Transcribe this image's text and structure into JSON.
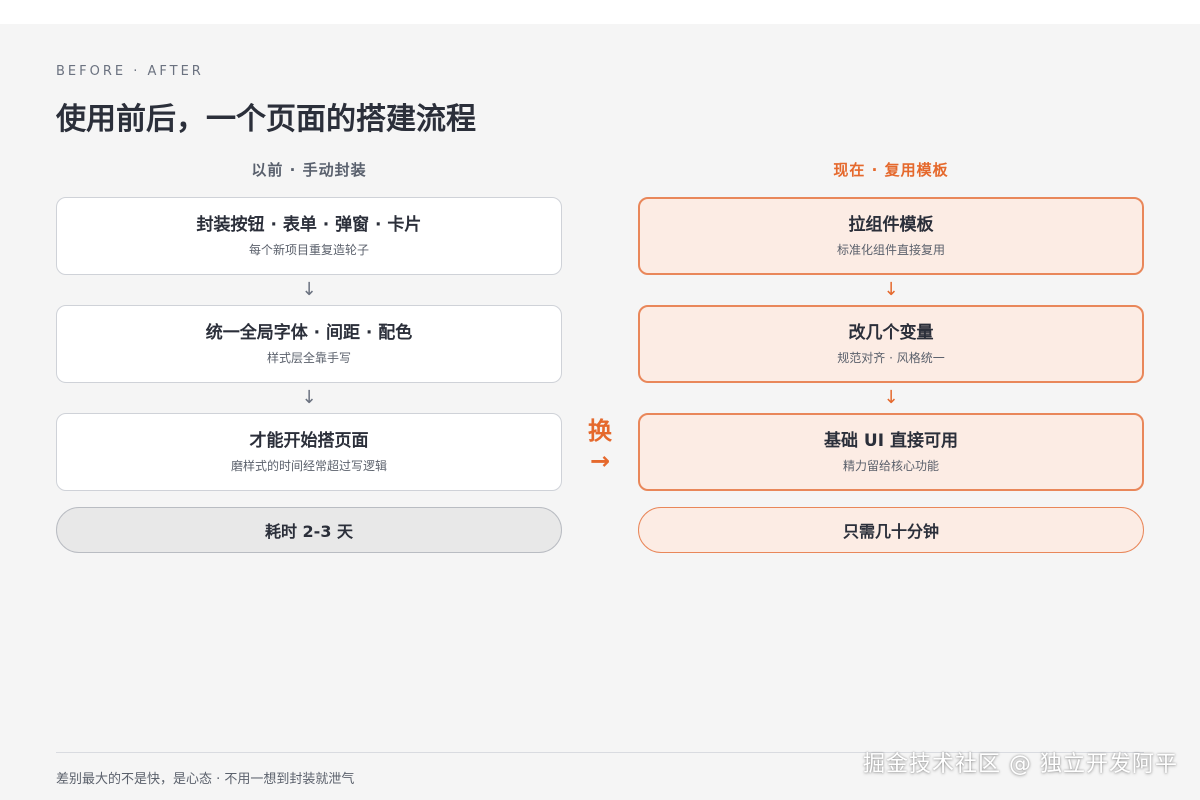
{
  "header": {
    "kicker": "BEFORE · AFTER",
    "title": "使用前后，一个页面的搭建流程"
  },
  "before": {
    "title": "以前 · 手动封装",
    "steps": [
      {
        "title": "封装按钮 · 表单 · 弹窗 · 卡片",
        "subtitle": "每个新项目重复造轮子"
      },
      {
        "title": "统一全局字体 · 间距 · 配色",
        "subtitle": "样式层全靠手写"
      },
      {
        "title": "才能开始搭页面",
        "subtitle": "磨样式的时间经常超过写逻辑"
      }
    ],
    "arrow": "↓",
    "result": "耗时 2-3 天"
  },
  "after": {
    "title": "现在 · 复用模板",
    "steps": [
      {
        "title": "拉组件模板",
        "subtitle": "标准化组件直接复用"
      },
      {
        "title": "改几个变量",
        "subtitle": "规范对齐 · 风格统一"
      },
      {
        "title": "基础 UI 直接可用",
        "subtitle": "精力留给核心功能"
      }
    ],
    "arrow": "↓",
    "result": "只需几十分钟"
  },
  "swap": {
    "label": "换",
    "arrow": "→"
  },
  "footer": {
    "note": "差别最大的不是快，是心态 · 不用一想到封装就泄气"
  },
  "watermark": {
    "text": "掘金技术社区 @ 独立开发阿平"
  },
  "colors": {
    "accent": "#e5692d",
    "accent_fill": "#fcece4",
    "text": "#2b2f3a",
    "muted": "#5b616c",
    "background": "#f5f5f5"
  }
}
